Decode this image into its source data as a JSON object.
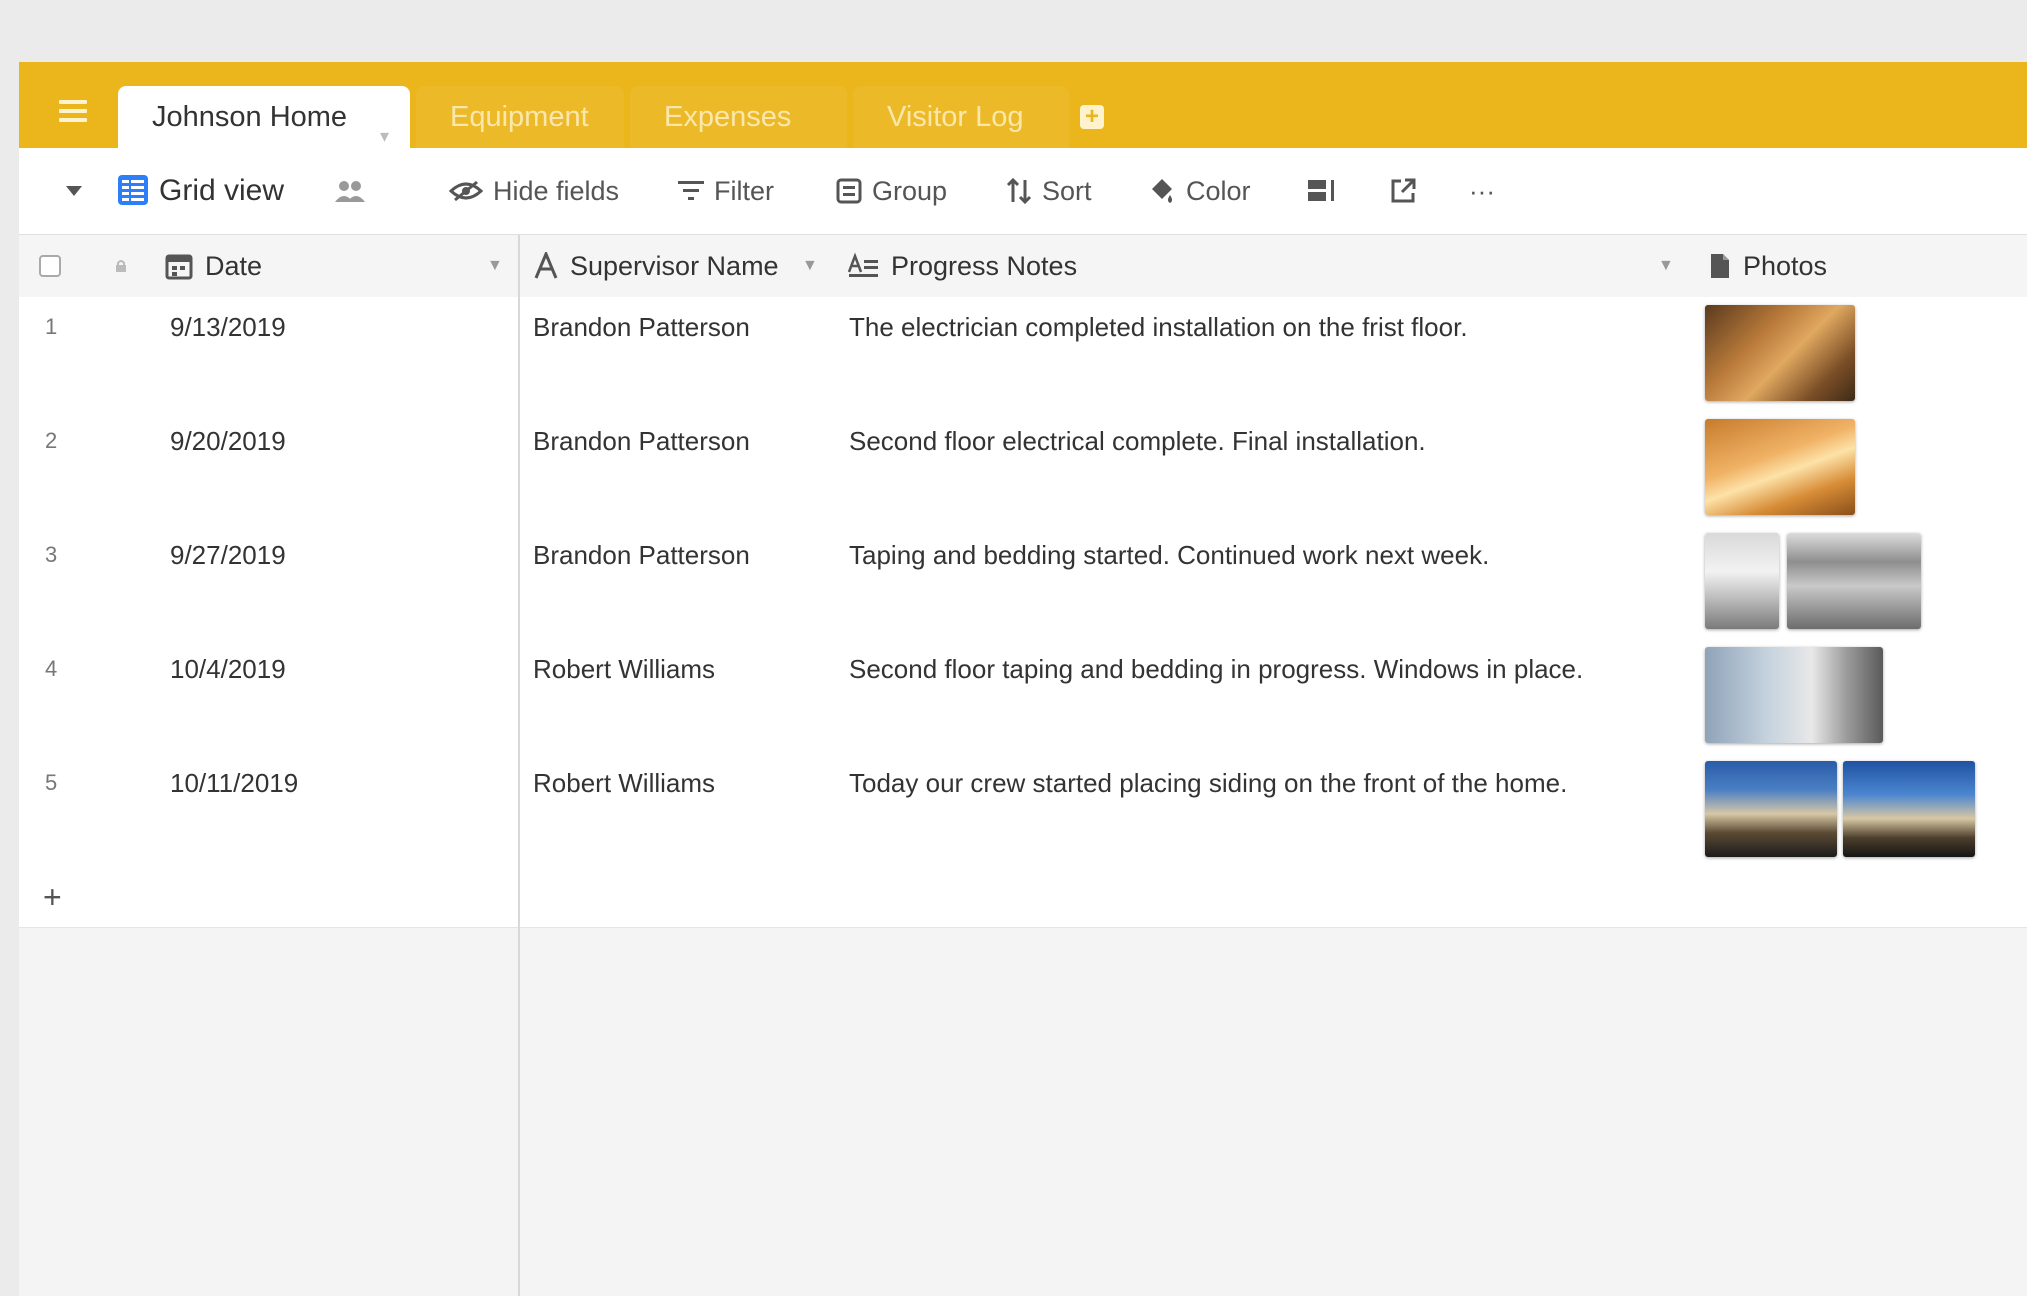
{
  "tabs": [
    {
      "label": "Johnson Home",
      "active": true
    },
    {
      "label": "Equipment",
      "active": false
    },
    {
      "label": "Expenses",
      "active": false
    },
    {
      "label": "Visitor Log",
      "active": false
    }
  ],
  "toolbar": {
    "view_name": "Grid view",
    "hide_fields": "Hide fields",
    "filter": "Filter",
    "group": "Group",
    "sort": "Sort",
    "color": "Color",
    "more": "···"
  },
  "columns": {
    "date": "Date",
    "supervisor": "Supervisor Name",
    "notes": "Progress Notes",
    "photos": "Photos"
  },
  "rows": [
    {
      "num": "1",
      "date": "9/13/2019",
      "supervisor": "Brandon Patterson",
      "notes": "The electrician completed installation on the frist floor.",
      "photos": [
        "t-wood1"
      ]
    },
    {
      "num": "2",
      "date": "9/20/2019",
      "supervisor": "Brandon Patterson",
      "notes": "Second floor electrical complete. Final installation.",
      "photos": [
        "t-wood2"
      ]
    },
    {
      "num": "3",
      "date": "9/27/2019",
      "supervisor": "Brandon Patterson",
      "notes": "Taping and bedding started. Continued work next week.",
      "photos": [
        "t-room1",
        "t-room2"
      ]
    },
    {
      "num": "4",
      "date": "10/4/2019",
      "supervisor": "Robert Williams",
      "notes": "Second floor taping and bedding in progress. Windows in place.",
      "photos": [
        "t-room3"
      ]
    },
    {
      "num": "5",
      "date": "10/11/2019",
      "supervisor": "Robert Williams",
      "notes": "Today our crew started placing siding on the front of the home.",
      "photos": [
        "t-house1",
        "t-house2"
      ]
    }
  ],
  "add_row_symbol": "+",
  "colors": {
    "tab_bar": "#ebb61c",
    "grid_icon": "#2d7ff9"
  }
}
